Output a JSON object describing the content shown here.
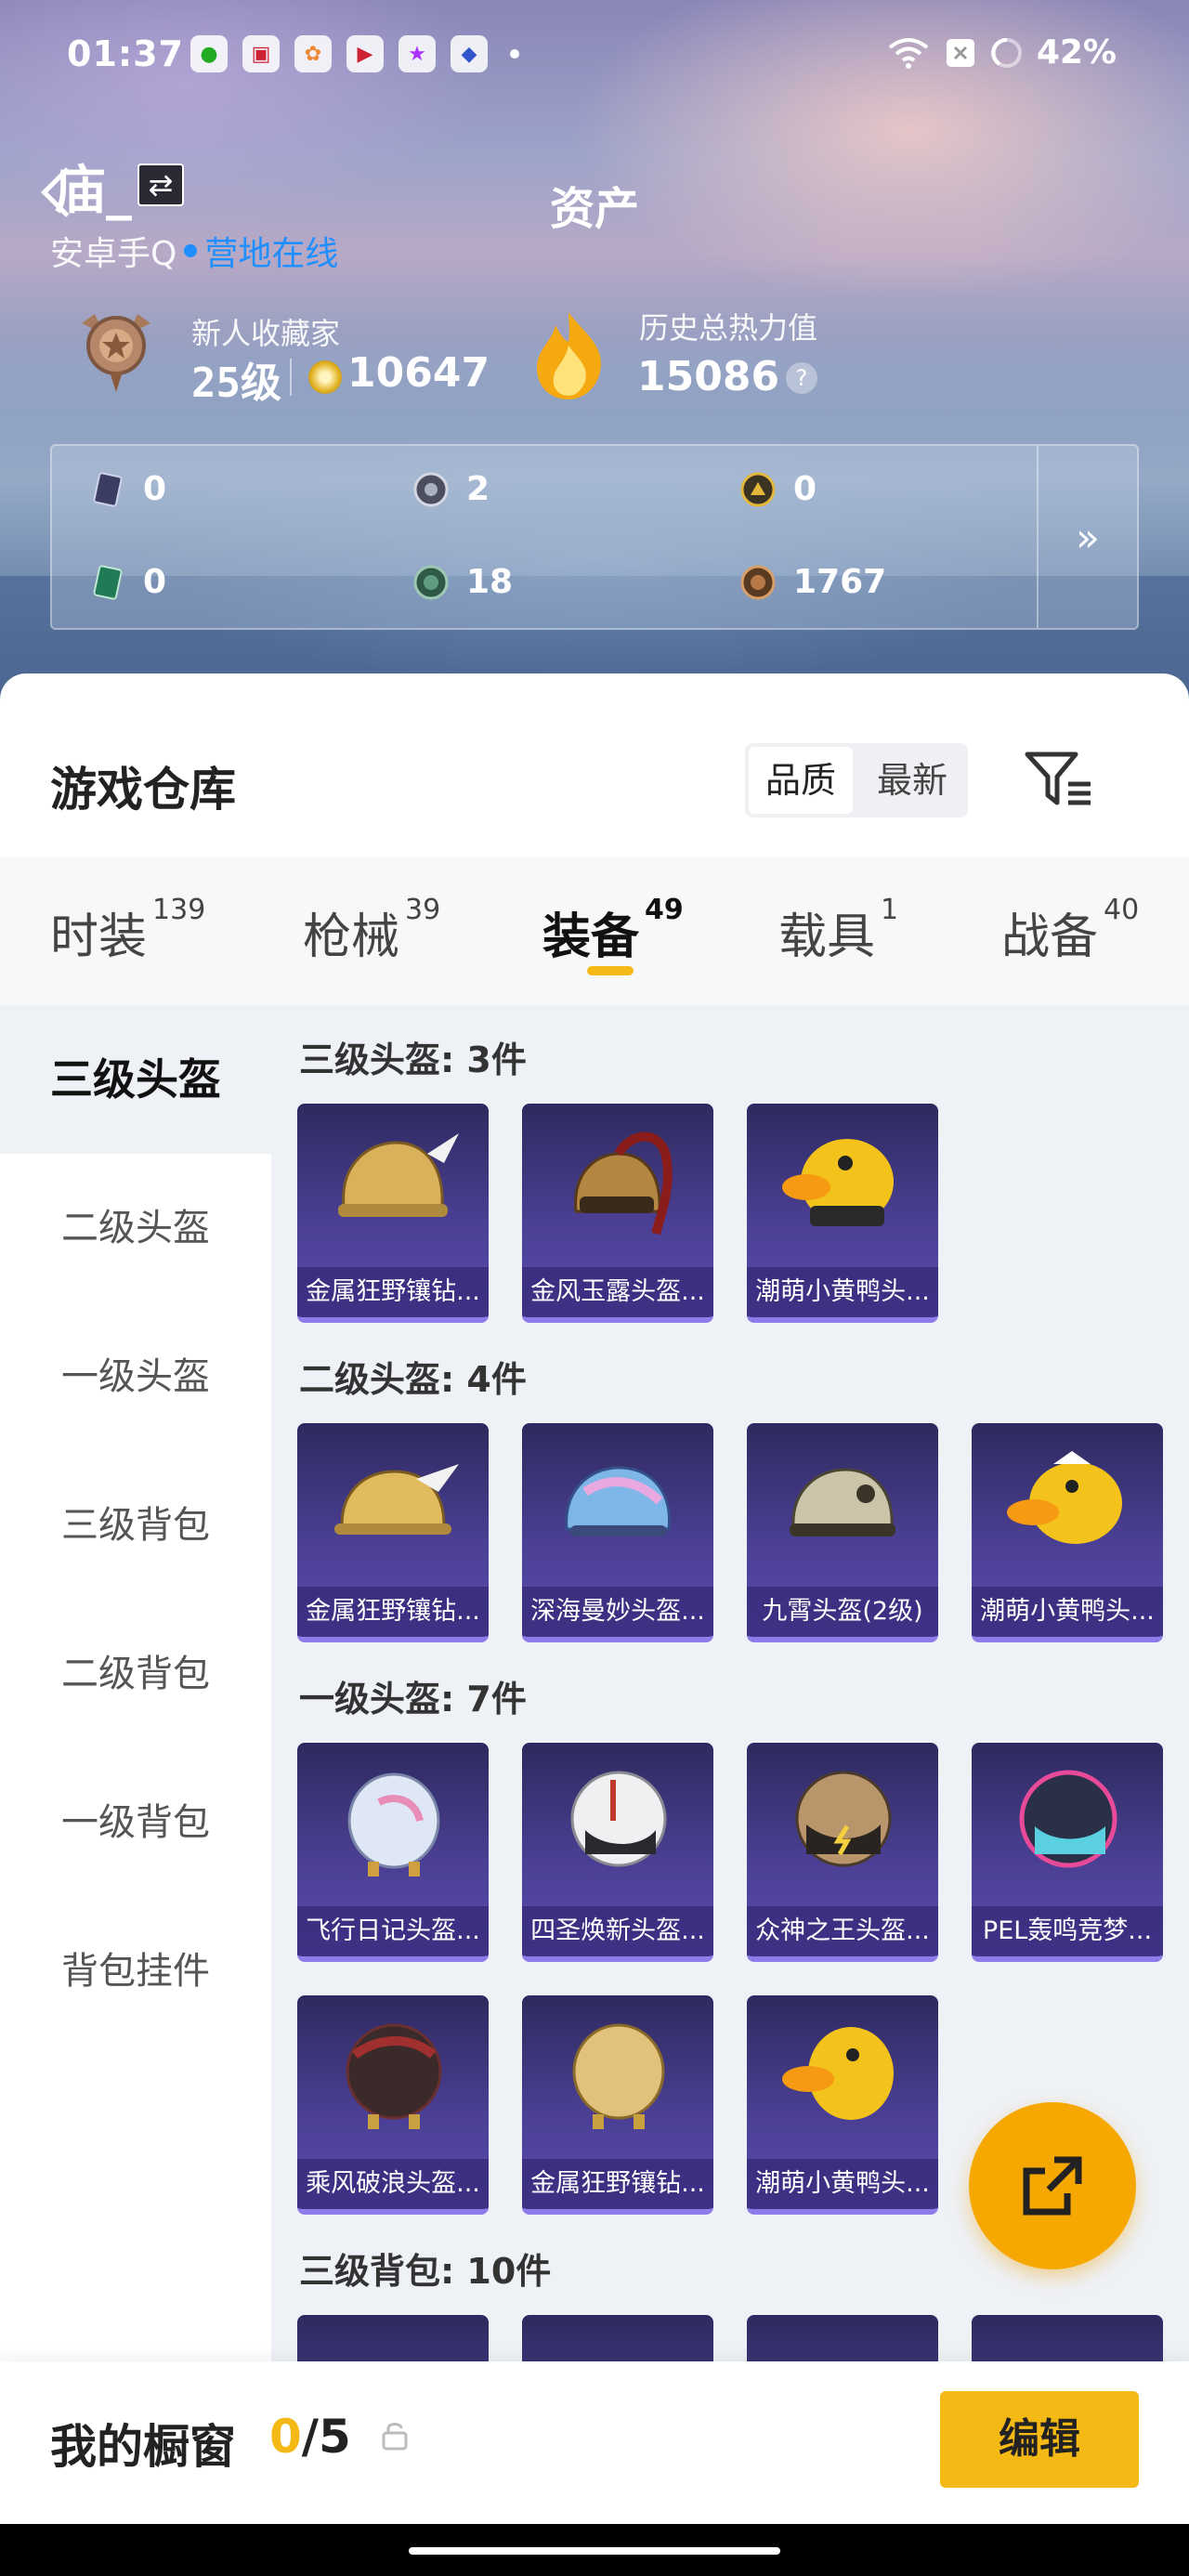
{
  "status": {
    "time": "01:37",
    "battery": "42%"
  },
  "header": {
    "username": "庙_",
    "title": "资产",
    "platform": "安卓手Q",
    "online": "营地在线"
  },
  "profile": {
    "rank_title": "新人收藏家",
    "level": "25级",
    "coins": "10647",
    "heat_title": "历史总热力值",
    "heat_value": "15086",
    "help": "?"
  },
  "assets": [
    {
      "icon": "card-icon",
      "value": "0"
    },
    {
      "icon": "silver-token-icon",
      "value": "2"
    },
    {
      "icon": "gold-token-icon",
      "value": "0"
    },
    {
      "icon": "green-card-icon",
      "value": "0"
    },
    {
      "icon": "green-token-icon",
      "value": "18"
    },
    {
      "icon": "bronze-token-icon",
      "value": "1767"
    }
  ],
  "assets_more": "»",
  "warehouse": {
    "title": "游戏仓库",
    "sort": [
      "品质",
      "最新"
    ]
  },
  "tabs": [
    {
      "label": "时装",
      "count": "139"
    },
    {
      "label": "枪械",
      "count": "39"
    },
    {
      "label": "装备",
      "count": "49"
    },
    {
      "label": "载具",
      "count": "1"
    },
    {
      "label": "战备",
      "count": "40"
    }
  ],
  "nav": [
    "三级头盔",
    "二级头盔",
    "一级头盔",
    "三级背包",
    "二级背包",
    "一级背包",
    "背包挂件"
  ],
  "sections": [
    {
      "title": "三级头盔: 3件",
      "items": [
        "金属狂野镶钻...",
        "金风玉露头盔...",
        "潮萌小黄鸭头..."
      ]
    },
    {
      "title": "二级头盔: 4件",
      "items": [
        "金属狂野镶钻...",
        "深海曼妙头盔...",
        "九霄头盔(2级)",
        "潮萌小黄鸭头..."
      ]
    },
    {
      "title": "一级头盔: 7件",
      "items": [
        "飞行日记头盔...",
        "四圣焕新头盔...",
        "众神之王头盔...",
        "PEL轰鸣竞梦...",
        "乘风破浪头盔...",
        "金属狂野镶钻...",
        "潮萌小黄鸭头..."
      ]
    },
    {
      "title": "三级背包: 10件",
      "items": []
    }
  ],
  "showcase": {
    "label": "我的橱窗",
    "current": "0",
    "total": "/5",
    "edit": "编辑"
  }
}
